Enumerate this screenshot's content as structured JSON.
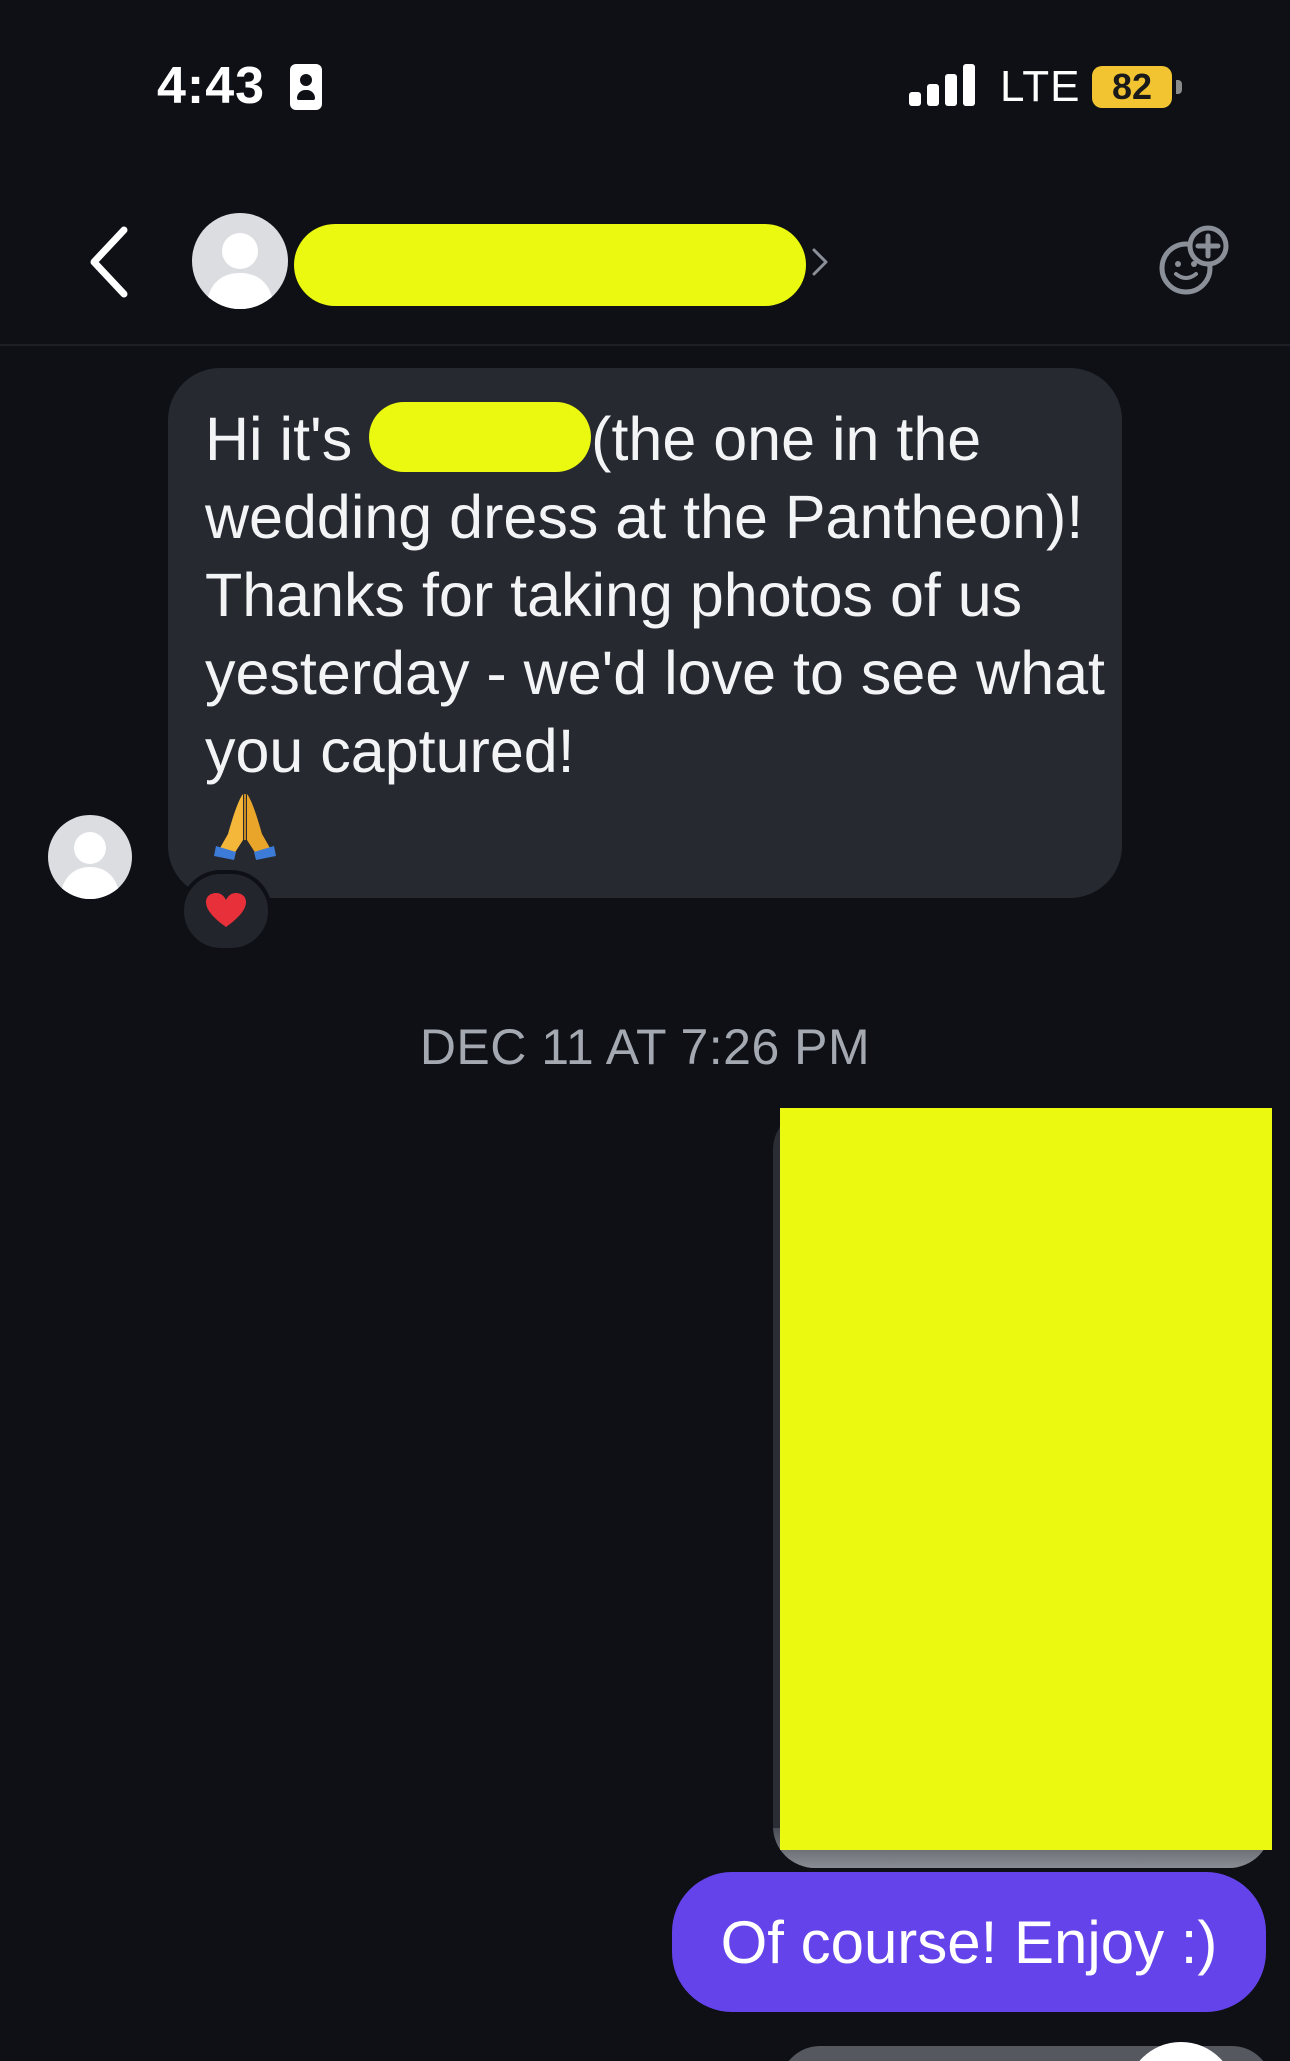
{
  "status_bar": {
    "time": "4:43",
    "network": "LTE",
    "battery": "82",
    "battery_color": "#f2c431"
  },
  "header": {
    "back_icon": "chevron-left-icon",
    "contact_name": "",
    "contact_name_redaction_color": "#eaf90f",
    "add_icon": "face-plus-icon"
  },
  "conversation": {
    "incoming": {
      "text_before": "Hi it's ",
      "redacted_name": "",
      "text_after": "(the one in the wedding dress at the Pantheon)! Thanks for taking photos of us yesterday - we'd love to see what you captured!",
      "emoji": "folded-hands",
      "reaction": "red-heart",
      "bubble_color": "#262930"
    },
    "timestamp": "DEC 11 AT 7:26 PM",
    "outgoing_photo_redacted": true,
    "outgoing_text": "Of course! Enjoy :)",
    "outgoing_bubble_color": "#6543ea"
  }
}
